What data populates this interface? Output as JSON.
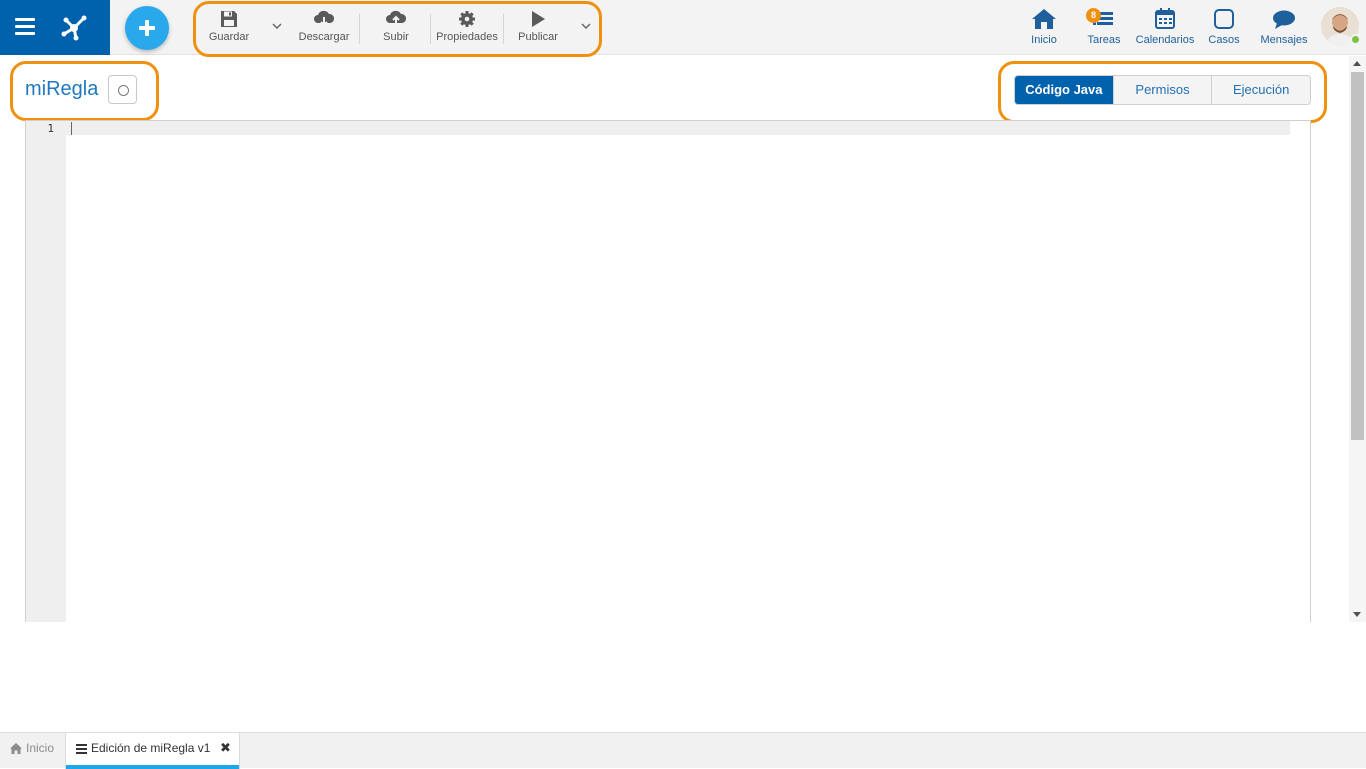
{
  "toolbar": {
    "save_label": "Guardar",
    "download_label": "Descargar",
    "upload_label": "Subir",
    "properties_label": "Propiedades",
    "publish_label": "Publicar"
  },
  "nav": {
    "home_label": "Inicio",
    "tasks_label": "Tareas",
    "tasks_badge": "8",
    "calendars_label": "Calendarios",
    "cases_label": "Casos",
    "messages_label": "Mensajes"
  },
  "page": {
    "title": "miRegla"
  },
  "tabs": [
    {
      "label": "Código Java",
      "active": true
    },
    {
      "label": "Permisos",
      "active": false
    },
    {
      "label": "Ejecución",
      "active": false
    }
  ],
  "editor": {
    "line_numbers": [
      "1"
    ]
  },
  "bottom_tabs": {
    "home_label": "Inicio",
    "doc_label": "Edición de miRegla v1"
  },
  "colors": {
    "brand": "#0061ad",
    "accent": "#2aa8ec",
    "highlight": "#f0900f",
    "link": "#1f78c1"
  }
}
